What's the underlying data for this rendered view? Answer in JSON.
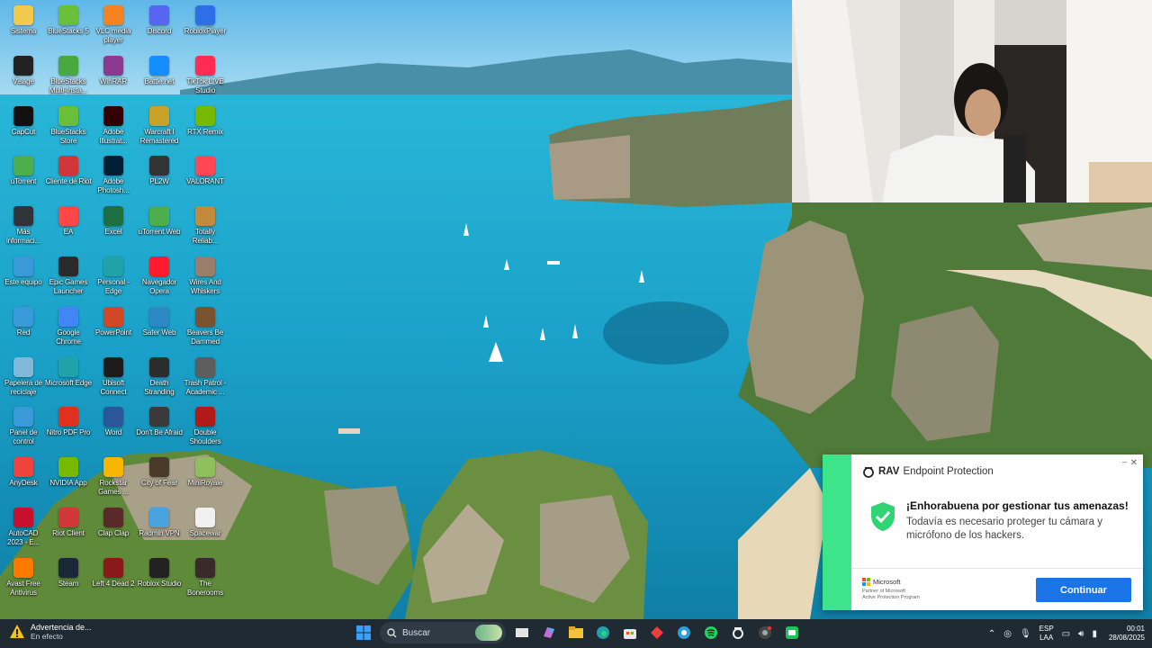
{
  "desktop": {
    "icons": [
      {
        "label": "Sistema",
        "icon": "folder-icon",
        "color": "#f2c94c"
      },
      {
        "label": "BlueStacks 5",
        "icon": "bluestacks-icon",
        "color": "#6abf3a"
      },
      {
        "label": "VLC media player",
        "icon": "vlc-icon",
        "color": "#f58220"
      },
      {
        "label": "Discord",
        "icon": "discord-icon",
        "color": "#5865f2"
      },
      {
        "label": "RobloxPlayer",
        "icon": "roblox-icon",
        "color": "#2e6fe8"
      },
      {
        "label": "Visage",
        "icon": "visage-icon",
        "color": "#222222"
      },
      {
        "label": "BlueStacks Multi-Insta...",
        "icon": "bluestacks-multi-icon",
        "color": "#4aa840"
      },
      {
        "label": "WinRAR",
        "icon": "winrar-icon",
        "color": "#8b3a8f"
      },
      {
        "label": "Battle.net",
        "icon": "battlenet-icon",
        "color": "#148eff"
      },
      {
        "label": "TikTok LIVE Studio",
        "icon": "tiktok-icon",
        "color": "#fe2c55"
      },
      {
        "label": "CapCut",
        "icon": "capcut-icon",
        "color": "#111111"
      },
      {
        "label": "BlueStacks Store",
        "icon": "bluestacks-store-icon",
        "color": "#6abf3a"
      },
      {
        "label": "Adobe Illustrat...",
        "icon": "illustrator-icon",
        "color": "#330000"
      },
      {
        "label": "Warcraft I Remastered",
        "icon": "warcraft-icon",
        "color": "#c9a227"
      },
      {
        "label": "RTX Remix",
        "icon": "rtx-icon",
        "color": "#76b900"
      },
      {
        "label": "uTorrent",
        "icon": "utorrent-icon",
        "color": "#4cae4c"
      },
      {
        "label": "Cliente de Riot",
        "icon": "riot-icon",
        "color": "#d13639"
      },
      {
        "label": "Adobe Photosh...",
        "icon": "photoshop-icon",
        "color": "#001e36"
      },
      {
        "label": "PL2W",
        "icon": "pl2w-icon",
        "color": "#333333"
      },
      {
        "label": "VALORANT",
        "icon": "valorant-icon",
        "color": "#ff4655"
      },
      {
        "label": "Más informaci...",
        "icon": "info-icon",
        "color": "#30343a"
      },
      {
        "label": "EA",
        "icon": "ea-icon",
        "color": "#ff4747"
      },
      {
        "label": "Excel",
        "icon": "excel-icon",
        "color": "#1d6f42"
      },
      {
        "label": "uTorrent Web",
        "icon": "utorrent-web-icon",
        "color": "#4cae4c"
      },
      {
        "label": "Totally Reliab...",
        "icon": "totally-reliable-icon",
        "color": "#c28a3a"
      },
      {
        "label": "Este equipo",
        "icon": "computer-icon",
        "color": "#3a9ad9"
      },
      {
        "label": "Epic Games Launcher",
        "icon": "epic-icon",
        "color": "#2a2a2a"
      },
      {
        "label": "Personal - Edge",
        "icon": "edge-icon",
        "color": "#1fa2a8"
      },
      {
        "label": "Navegador Opera",
        "icon": "opera-icon",
        "color": "#ff1b2d"
      },
      {
        "label": "Wires And Whiskers",
        "icon": "wires-icon",
        "color": "#9a7d6a"
      },
      {
        "label": "Red",
        "icon": "network-icon",
        "color": "#3a9ad9"
      },
      {
        "label": "Google Chrome",
        "icon": "chrome-icon",
        "color": "#4285f4"
      },
      {
        "label": "PowerPoint",
        "icon": "powerpoint-icon",
        "color": "#d24726"
      },
      {
        "label": "Safer Web",
        "icon": "saferweb-icon",
        "color": "#2c89c6"
      },
      {
        "label": "Beavers Be Dammed",
        "icon": "beavers-icon",
        "color": "#7a5230"
      },
      {
        "label": "Papelera de reciclaje",
        "icon": "recycle-bin-icon",
        "color": "#7fb8d8"
      },
      {
        "label": "Microsoft Edge",
        "icon": "edge-icon",
        "color": "#1fa2a8"
      },
      {
        "label": "Ubisoft Connect",
        "icon": "ubisoft-icon",
        "color": "#1b1b1b"
      },
      {
        "label": "Death Stranding",
        "icon": "death-stranding-icon",
        "color": "#2c2c2c"
      },
      {
        "label": "Trash Patrol - Academic ...",
        "icon": "trash-patrol-icon",
        "color": "#5d5d5d"
      },
      {
        "label": "Panel de control",
        "icon": "control-panel-icon",
        "color": "#3a9ad9"
      },
      {
        "label": "Nitro PDF Pro",
        "icon": "nitro-icon",
        "color": "#e0301e"
      },
      {
        "label": "Word",
        "icon": "word-icon",
        "color": "#2b579a"
      },
      {
        "label": "Don't Be Afraid",
        "icon": "dont-be-afraid-icon",
        "color": "#3a3a3a"
      },
      {
        "label": "Double Shoulders",
        "icon": "double-shoulders-icon",
        "color": "#b21a1a"
      },
      {
        "label": "AnyDesk",
        "icon": "anydesk-icon",
        "color": "#ef443b"
      },
      {
        "label": "NVIDIA App",
        "icon": "nvidia-icon",
        "color": "#76b900"
      },
      {
        "label": "Rockstar Games ...",
        "icon": "rockstar-icon",
        "color": "#f7b500"
      },
      {
        "label": "City of Fear",
        "icon": "city-of-fear-icon",
        "color": "#4a3a2a"
      },
      {
        "label": "MiniRoyale",
        "icon": "miniroyale-icon",
        "color": "#8fbf5a"
      },
      {
        "label": "AutoCAD 2023 - E...",
        "icon": "autocad-icon",
        "color": "#c8102e"
      },
      {
        "label": "Riot Client",
        "icon": "riot-client-icon",
        "color": "#d13639"
      },
      {
        "label": "Clap Clap",
        "icon": "clap-clap-icon",
        "color": "#5a2a2a"
      },
      {
        "label": "Radmin VPN",
        "icon": "radmin-icon",
        "color": "#4aa3df"
      },
      {
        "label": "Spacewar",
        "icon": "file-icon",
        "color": "#f0f0f0"
      },
      {
        "label": "Avast Free Antivirus",
        "icon": "avast-icon",
        "color": "#ff7800"
      },
      {
        "label": "Steam",
        "icon": "steam-icon",
        "color": "#1b2838"
      },
      {
        "label": "Left 4 Dead 2",
        "icon": "left4dead-icon",
        "color": "#8a1a1a"
      },
      {
        "label": "Roblox Studio",
        "icon": "roblox-studio-icon",
        "color": "#222222"
      },
      {
        "label": "The Bonerooms",
        "icon": "bonerooms-icon",
        "color": "#3a2a2a"
      }
    ]
  },
  "notification": {
    "brand_bold": "RAV",
    "brand_product": "Endpoint Protection",
    "heading": "¡Enhorabuena por gestionar tus amenazas!",
    "body": "Todavía es necesario proteger tu cámara y micrófono de los hackers.",
    "partner_name": "Microsoft",
    "partner_line1": "Partner of Microsoft",
    "partner_line2": "Active Protection Program",
    "cta_label": "Continuar",
    "accent": "#3ee48a",
    "button_color": "#1a74e8"
  },
  "taskbar": {
    "warning_title": "Advertencia de...",
    "warning_status": "En efecto",
    "search_placeholder": "Buscar",
    "pinned": [
      "start-icon",
      "search",
      "widgets-icon",
      "task-view-icon",
      "copilot-icon",
      "file-explorer-icon",
      "edge-icon",
      "store-icon",
      "app-red-icon",
      "chrome-icon",
      "spotify-icon",
      "ring-icon",
      "chrome-alt-icon",
      "app-green-icon"
    ],
    "lang_line1": "ESP",
    "lang_line2": "LAA",
    "time": "00:01",
    "date": "28/08/2025"
  }
}
